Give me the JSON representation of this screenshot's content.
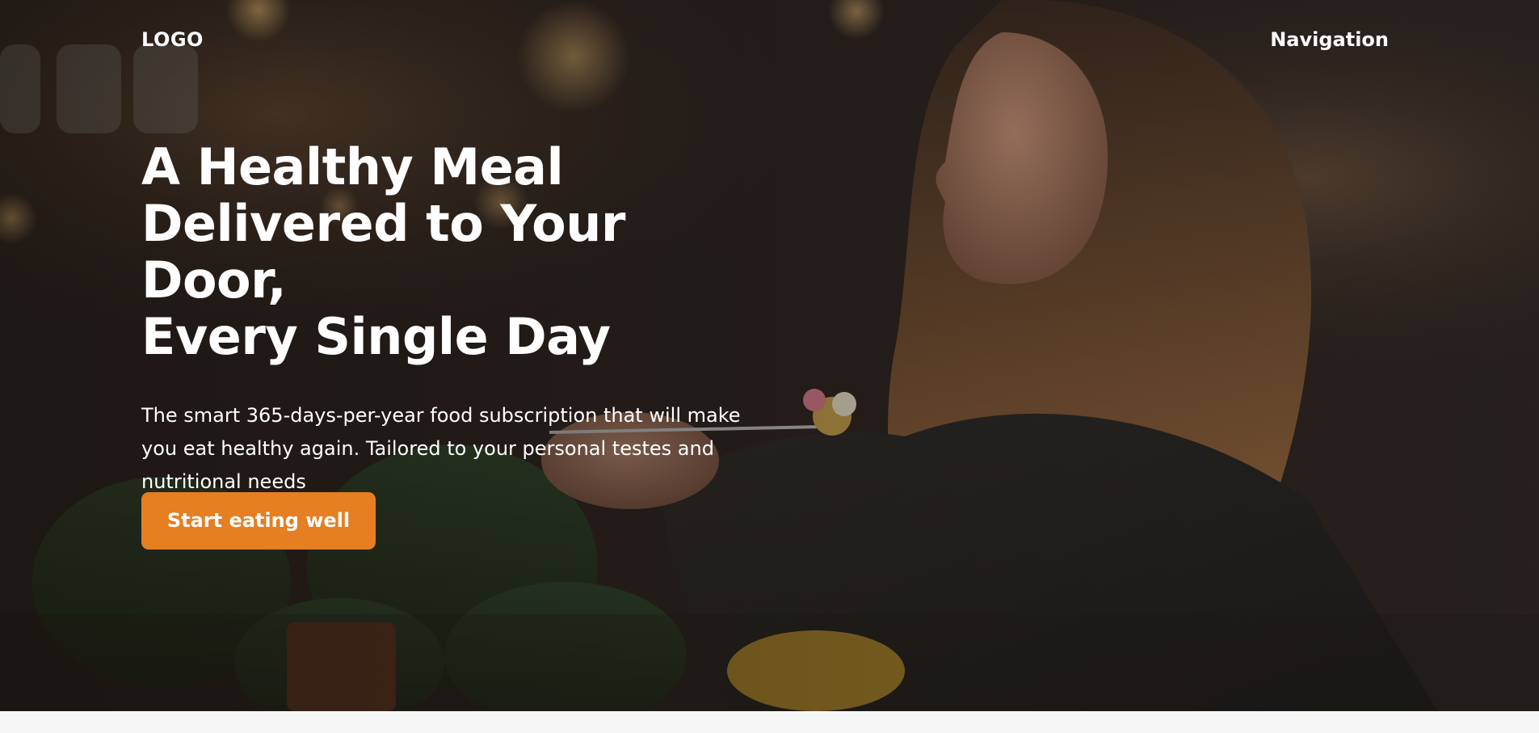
{
  "header": {
    "logo": "LOGO",
    "navigation": "Navigation"
  },
  "hero": {
    "title_lines": [
      "A Healthy Meal",
      "Delivered to Your Door,",
      "Every Single Day"
    ],
    "description": "The smart 365-days-per-year food subscription that will make you eat healthy again. Tailored to your personal testes and nutritional needs",
    "cta_label": "Start eating well"
  },
  "colors": {
    "accent": "#e67e22",
    "text": "#ffffff",
    "page_background": "#f6f6f6"
  }
}
